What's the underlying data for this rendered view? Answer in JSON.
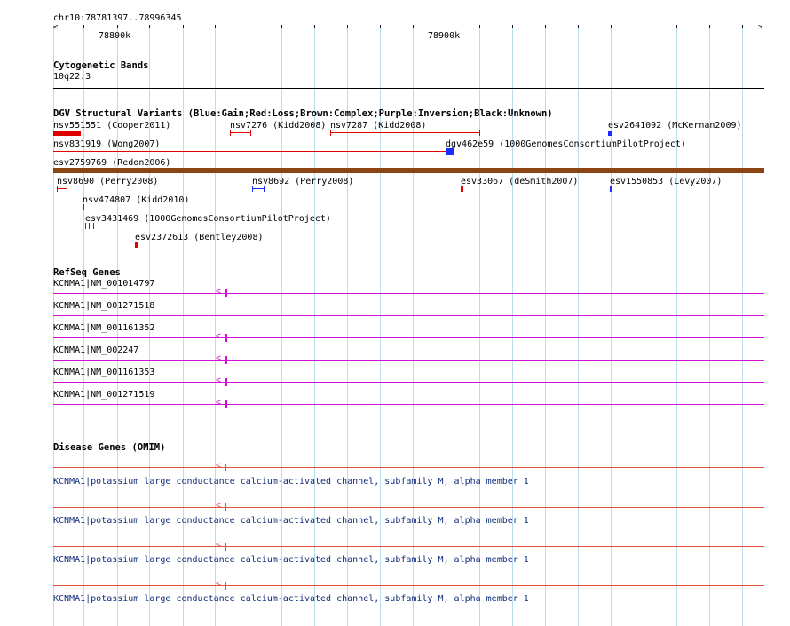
{
  "ruler": {
    "location": "chr10:78781397..78996345",
    "tick_labels": [
      "78800k",
      "78900k"
    ]
  },
  "cytobands": {
    "title": "Cytogenetic Bands",
    "band": "10q22.3"
  },
  "dgv": {
    "title": "DGV Structural Variants (Blue:Gain;Red:Loss;Brown:Complex;Purple:Inversion;Black:Unknown)",
    "items": [
      "nsv551551 (Cooper2011)",
      "nsv7276 (Kidd2008)",
      "nsv7287 (Kidd2008)",
      "esv2641092 (McKernan2009)",
      "nsv831919 (Wong2007)",
      "dgv462e59 (1000GenomesConsortiumPilotProject)",
      "esv2759769 (Redon2006)",
      "nsv8690 (Perry2008)",
      "nsv8692 (Perry2008)",
      "esv33067 (deSmith2007)",
      "esv1550853 (Levy2007)",
      "nsv474807 (Kidd2010)",
      "esv3431469 (1000GenomesConsortiumPilotProject)",
      "esv2372613 (Bentley2008)"
    ],
    "colors": {
      "gain": "#1a2cff",
      "loss": "#e00000",
      "complex": "#8b4513"
    }
  },
  "refseq": {
    "title": "RefSeq Genes",
    "genes": [
      "KCNMA1|NM_001014797",
      "KCNMA1|NM_001271518",
      "KCNMA1|NM_001161352",
      "KCNMA1|NM_002247",
      "KCNMA1|NM_001161353",
      "KCNMA1|NM_001271519"
    ],
    "color": "#d40fd4"
  },
  "omim": {
    "title": "Disease Genes (OMIM)",
    "genes": [
      "KCNMA1|potassium large conductance calcium-activated channel, subfamily M, alpha member 1",
      "KCNMA1|potassium large conductance calcium-activated channel, subfamily M, alpha member 1",
      "KCNMA1|potassium large conductance calcium-activated channel, subfamily M, alpha member 1",
      "KCNMA1|potassium large conductance calcium-activated channel, subfamily M, alpha member 1"
    ],
    "color": "#e2503b"
  }
}
